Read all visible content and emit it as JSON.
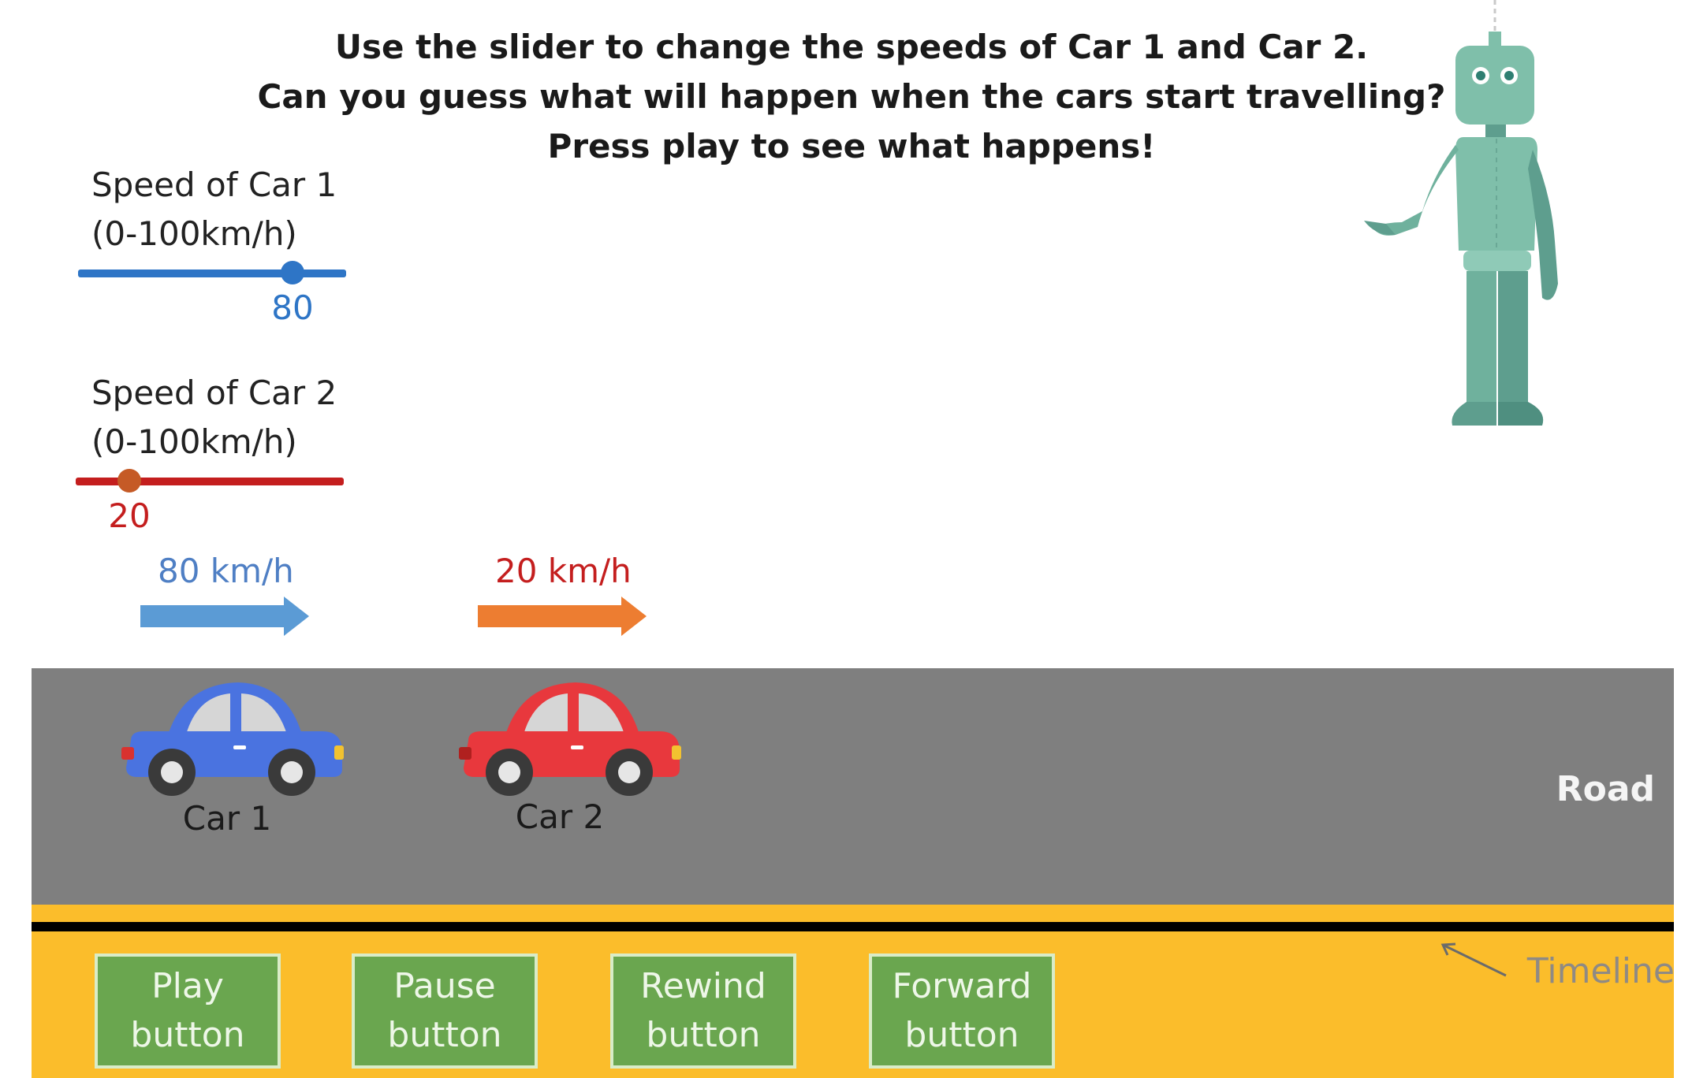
{
  "instructions": {
    "line1": "Use the slider to change the speeds of Car 1 and Car 2.",
    "line2": "Can you guess what will happen when the cars start travelling?",
    "line3": "Press play to see what happens!"
  },
  "slider_car1": {
    "title": "Speed of Car 1",
    "range": "(0-100km/h)",
    "value": "80",
    "value_fraction": 0.8,
    "color": "#2e75c6"
  },
  "slider_car2": {
    "title": "Speed of Car 2",
    "range": "(0-100km/h)",
    "value": "20",
    "value_fraction": 0.2,
    "color": "#c41e1e",
    "knob_color": "#c55a26"
  },
  "arrow_car1": {
    "label": "80 km/h",
    "color": "#5b9bd5"
  },
  "arrow_car2": {
    "label": "20 km/h",
    "color": "#ed7d31"
  },
  "road": {
    "label": "Road",
    "car1_label": "Car 1",
    "car2_label": "Car 2"
  },
  "timeline": {
    "label": "Timeline",
    "buttons": {
      "play": {
        "line1": "Play",
        "line2": "button"
      },
      "pause": {
        "line1": "Pause",
        "line2": "button"
      },
      "rewind": {
        "line1": "Rewind",
        "line2": "button"
      },
      "forward": {
        "line1": "Forward",
        "line2": "button"
      }
    }
  },
  "colors": {
    "road": "#7f7f7f",
    "timeline_strip": "#fbbd2b",
    "button_green": "#6aa64f",
    "car1": "#4a73e0",
    "car2": "#e8383d",
    "robot": "#7fbfaa"
  }
}
